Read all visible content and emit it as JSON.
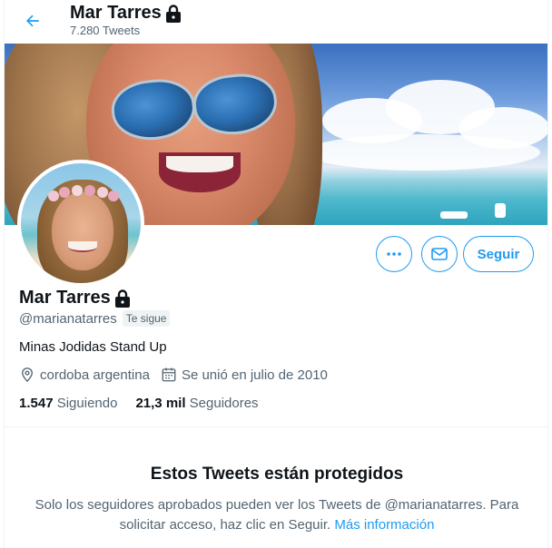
{
  "header": {
    "name": "Mar Tarres",
    "tweet_count": "7.280 Tweets",
    "back_icon": "arrow-left-icon",
    "lock_icon": "lock-icon"
  },
  "profile": {
    "name": "Mar Tarres",
    "handle": "@marianatarres",
    "follows_you": "Te sigue",
    "bio": "Minas Jodidas Stand Up",
    "location": "cordoba argentina",
    "joined": "Se unió en julio de 2010",
    "following_count": "1.547",
    "following_label": "Siguiendo",
    "followers_count": "21,3 mil",
    "followers_label": "Seguidores"
  },
  "actions": {
    "more_icon": "more-dots-icon",
    "message_icon": "envelope-icon",
    "follow_label": "Seguir"
  },
  "protected": {
    "title": "Estos Tweets están protegidos",
    "body": "Solo los seguidores aprobados pueden ver los Tweets de @marianatarres. Para solicitar acceso, haz clic en Seguir.",
    "link": "Más información"
  },
  "colors": {
    "accent": "#1d9bf0",
    "text": "#0f1419",
    "secondary": "#536471"
  }
}
